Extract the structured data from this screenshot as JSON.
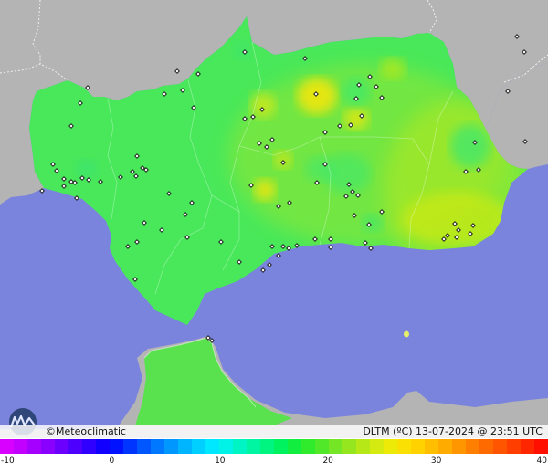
{
  "map": {
    "credit": "©Meteoclimatic",
    "caption": "DLTM (ºC)  13-07-2024 @ 23:51 UTC",
    "colors": {
      "sea": "#7b84dd",
      "outside_land": "#b4b4b4",
      "base_land": "#48e85a",
      "border": "#ffffff"
    }
  },
  "legend": {
    "unit": "ºC",
    "min": -10,
    "max": 40,
    "ticks": [
      "-10",
      "0",
      "10",
      "20",
      "30",
      "40"
    ],
    "colors": [
      "#d800ff",
      "#c200ff",
      "#a500ff",
      "#8a00ff",
      "#6c00ff",
      "#4e00ff",
      "#2f00ff",
      "#1200ff",
      "#0012ff",
      "#0034ff",
      "#0056ff",
      "#0078ff",
      "#0097ff",
      "#00b5ff",
      "#00d0ff",
      "#00e8ff",
      "#00f3e6",
      "#00f5c4",
      "#00f5a2",
      "#00f580",
      "#00f25e",
      "#12ee3f",
      "#30eb2c",
      "#52e82a",
      "#74e626",
      "#95e61f",
      "#b6e817",
      "#d5ea10",
      "#eeea08",
      "#fbe103",
      "#ffd200",
      "#ffbf00",
      "#ffab00",
      "#ff9600",
      "#ff8000",
      "#ff6a00",
      "#ff5400",
      "#ff3e00",
      "#ff2600",
      "#ff0f00"
    ]
  }
}
